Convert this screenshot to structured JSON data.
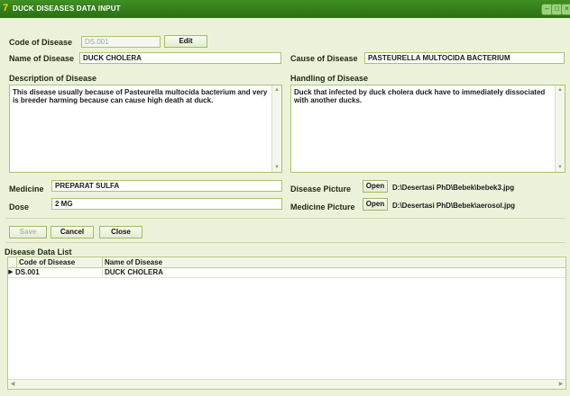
{
  "window": {
    "title": "DUCK DISEASES DATA INPUT"
  },
  "labels": {
    "code_of_disease": "Code of Disease",
    "name_of_disease": "Name of Disease",
    "cause_of_disease": "Cause of Disease",
    "description_of_disease": "Description of Disease",
    "handling_of_disease": "Handling of Disease",
    "medicine": "Medicine",
    "dose": "Dose",
    "disease_picture": "Disease Picture",
    "medicine_picture": "Medicine Picture",
    "disease_data_list": "Disease Data List"
  },
  "fields": {
    "code_of_disease": "DS.001",
    "name_of_disease": "DUCK CHOLERA",
    "cause_of_disease": "PASTEURELLA MULTOCIDA BACTERIUM",
    "description": "This disease usually because of Pasteurella multocida bacterium and very is breeder harming because can cause high death at duck.",
    "handling": "Duck that infected by duck cholera duck have to  immediately dissociated with another ducks.",
    "medicine": "PREPARAT SULFA",
    "dose": "2 MG",
    "disease_picture_path": "D:\\Desertasi PhD\\Bebek\\bebek3.jpg",
    "medicine_picture_path": "D:\\Desertasi PhD\\Bebek\\aerosol.jpg"
  },
  "buttons": {
    "edit": "Edit",
    "open_disease_picture": "Open",
    "open_medicine_picture": "Open",
    "save": "Save",
    "cancel": "Cancel",
    "close": "Close"
  },
  "grid": {
    "columns": [
      "Code of Disease",
      "Name of Disease"
    ],
    "rows": [
      {
        "code": "DS.001",
        "name": "DUCK CHOLERA"
      }
    ]
  },
  "colors": {
    "titlebar": "#2f7a1a",
    "background": "#ecf2d9",
    "border": "#a9c36f"
  }
}
